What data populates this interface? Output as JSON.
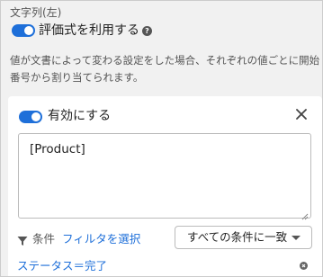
{
  "section": {
    "label": "文字列(左)"
  },
  "formula_toggle": {
    "label": "評価式を利用する",
    "help_icon_glyph": "?",
    "state": "on"
  },
  "description": {
    "text": "値が文書によって変わる設定をした場合、それぞれの値ごとに開始番号から割り当てられます。"
  },
  "entry": {
    "enable_toggle": {
      "label": "有効にする",
      "state": "on"
    },
    "close_icon": "close-icon",
    "text_value": "[Product]",
    "condition_label": "条件",
    "filter_link": "フィルタを選択",
    "match_select": {
      "selected": "すべての条件に一致"
    },
    "conditions": [
      {
        "text": "ステータス＝完了"
      }
    ]
  },
  "colors": {
    "accent": "#1e6fd9",
    "background": "#f1f1f1",
    "card": "#ffffff"
  }
}
